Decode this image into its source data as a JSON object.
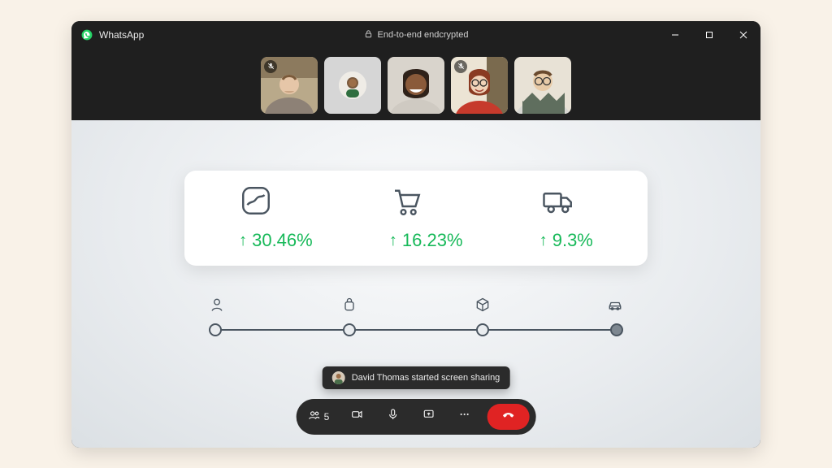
{
  "app": {
    "name": "WhatsApp"
  },
  "header": {
    "encryption_label": "End-to-end endcrypted"
  },
  "participants": {
    "count_label": "5",
    "tiles": [
      {
        "muted": true,
        "kind": "video"
      },
      {
        "muted": false,
        "kind": "avatar"
      },
      {
        "muted": false,
        "kind": "video"
      },
      {
        "muted": true,
        "kind": "video"
      },
      {
        "muted": false,
        "kind": "video"
      }
    ]
  },
  "share_content": {
    "stats": [
      {
        "icon": "analytics-icon",
        "value": "30.46%",
        "trend": "up"
      },
      {
        "icon": "cart-icon",
        "value": "16.23%",
        "trend": "up"
      },
      {
        "icon": "truck-icon",
        "value": "9.3%",
        "trend": "up"
      }
    ],
    "steps": [
      "user",
      "bag",
      "package",
      "car"
    ]
  },
  "toast": {
    "text": "David Thomas started screen sharing"
  },
  "controls": {
    "participants_icon": "people-icon",
    "camera_icon": "camera-icon",
    "mic_icon": "microphone-icon",
    "screen_icon": "screenshare-icon",
    "more_icon": "more-icon",
    "end_icon": "hangup-icon"
  }
}
